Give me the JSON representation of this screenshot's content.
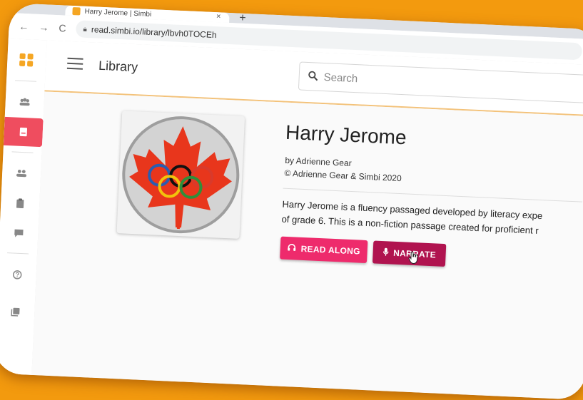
{
  "browser": {
    "tab_title": "Harry Jerome | Simbi",
    "tab_close": "×",
    "new_tab": "+",
    "back": "←",
    "forward": "→",
    "reload": "C",
    "url": "read.simbi.io/library/lbvh0TOCEh"
  },
  "header": {
    "title": "Library",
    "search_placeholder": "Search"
  },
  "sidebar": {
    "items": [
      {
        "icon": "groups-icon"
      },
      {
        "icon": "book-icon",
        "active": true
      },
      {
        "icon": "people-icon"
      },
      {
        "icon": "clipboard-icon"
      },
      {
        "icon": "chat-icon"
      },
      {
        "icon": "help-icon"
      },
      {
        "icon": "library-icon"
      }
    ]
  },
  "book": {
    "title": "Harry Jerome",
    "author": "by Adrienne Gear",
    "copyright": "© Adrienne Gear & Simbi 2020",
    "description_line1": "Harry Jerome is a fluency passaged developed by literacy expe",
    "description_line2": "of grade 6. This is a non-fiction passage created for proficient r"
  },
  "actions": {
    "read_along": "READ ALONG",
    "narrate": "NARRATE"
  },
  "colors": {
    "background": "#f39a0e",
    "accent_pink": "#ee2b6c",
    "accent_dark_pink": "#b0134f",
    "active_sidebar": "#ef4d5f",
    "maple_leaf": "#e8361c"
  }
}
